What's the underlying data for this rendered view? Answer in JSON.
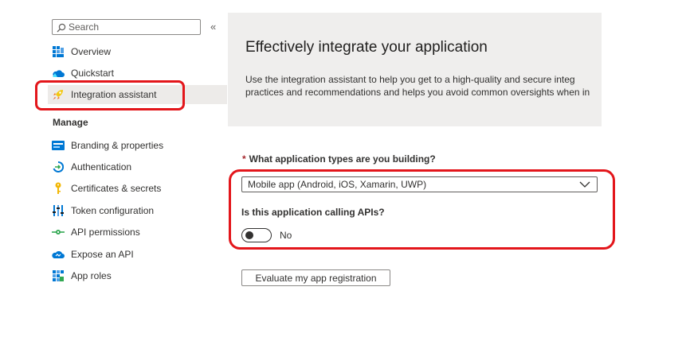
{
  "search": {
    "placeholder": "Search"
  },
  "collapse_glyph": "«",
  "nav": {
    "items_top": [
      {
        "label": "Overview",
        "icon": "overview-grid-icon"
      },
      {
        "label": "Quickstart",
        "icon": "quickstart-cloud-icon"
      },
      {
        "label": "Integration assistant",
        "icon": "rocket-icon",
        "selected": true
      }
    ],
    "section_label": "Manage",
    "items_manage": [
      {
        "label": "Branding & properties",
        "icon": "branding-card-icon"
      },
      {
        "label": "Authentication",
        "icon": "authentication-icon"
      },
      {
        "label": "Certificates & secrets",
        "icon": "key-icon"
      },
      {
        "label": "Token configuration",
        "icon": "token-bars-icon"
      },
      {
        "label": "API permissions",
        "icon": "api-permissions-icon"
      },
      {
        "label": "Expose an API",
        "icon": "expose-api-cloud-icon"
      },
      {
        "label": "App roles",
        "icon": "app-roles-grid-icon"
      }
    ]
  },
  "hero": {
    "title": "Effectively integrate your application",
    "line1": "Use the integration assistant to help you get to a high-quality and secure integ",
    "line2": "practices and recommendations and helps you avoid common oversights when in"
  },
  "form": {
    "required_mark": "*",
    "app_types_label": "What application types are you building?",
    "app_type_selected": "Mobile app (Android, iOS, Xamarin, UWP)",
    "calling_apis_label": "Is this application calling APIs?",
    "calling_apis_toggle": "No",
    "evaluate_button": "Evaluate my app registration"
  },
  "colors": {
    "highlight": "#e3161b",
    "accent_blue": "#0078d4",
    "hero_bg": "#efeeed",
    "selected_bg": "#edebe9",
    "required": "#a4262c"
  }
}
